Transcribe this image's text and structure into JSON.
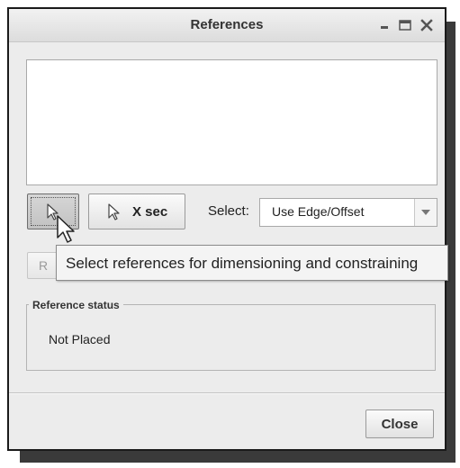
{
  "window": {
    "title": "References",
    "minimize_icon": "minimize-icon",
    "maximize_icon": "maximize-icon",
    "close_icon": "close-icon"
  },
  "references_list": {
    "items": []
  },
  "toolbar": {
    "pick_button_icon": "arrow-cursor-icon",
    "xsec_label": "X sec",
    "xsec_icon": "arrow-cursor-icon",
    "select_label": "Select:",
    "select_value": "Use Edge/Offset",
    "select_arrow_icon": "chevron-down-icon"
  },
  "partial_button": {
    "label": "R"
  },
  "tooltip": {
    "text": "Select references for dimensioning and constraining"
  },
  "reference_status": {
    "title": "Reference status",
    "value": "Not Placed"
  },
  "footer": {
    "close_label": "Close"
  },
  "colors": {
    "dialog_bg": "#ececec",
    "border": "#1a1a1a",
    "shadow": "#3a3a3a"
  }
}
